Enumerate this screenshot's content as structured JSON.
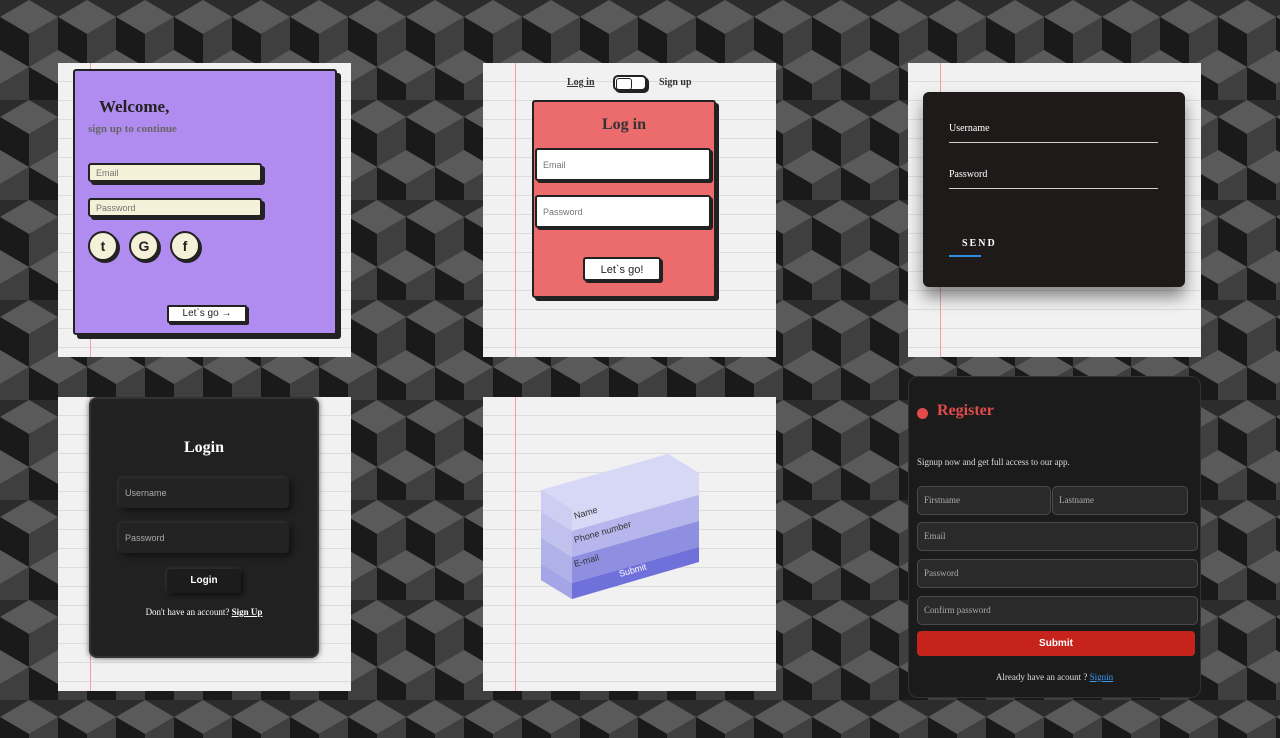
{
  "colors": {
    "background": "#2e2e2e",
    "paper": "#f1f1f1",
    "purple": "#b18cf0",
    "coral": "#ec6b6c",
    "dark": "#1e1a1a",
    "register_red": "#e24b4b",
    "link_blue": "#3b9cf2"
  },
  "card1": {
    "title": "Welcome,",
    "subtitle": "sign up to continue",
    "email_placeholder": "Email",
    "password_placeholder": "Password",
    "social": [
      {
        "icon": "twitter-icon",
        "glyph": "t"
      },
      {
        "icon": "google-icon",
        "glyph": "G"
      },
      {
        "icon": "facebook-icon",
        "glyph": "f"
      }
    ],
    "button_label": "Let`s go →"
  },
  "card2": {
    "toggle_login": "Log in",
    "toggle_signup": "Sign up",
    "title": "Log in",
    "email_placeholder": "Email",
    "password_placeholder": "Password",
    "button_label": "Let`s go!"
  },
  "card3": {
    "username_label": "Username",
    "password_label": "Password",
    "send_label": "SEND"
  },
  "card4": {
    "title": "Login",
    "username_placeholder": "Username",
    "password_placeholder": "Password",
    "button_label": "Login",
    "footer_text": "Don't have an account?",
    "signup_link": "Sign Up"
  },
  "card5": {
    "fields": [
      "Name",
      "Phone number",
      "E-mail"
    ],
    "submit_label": "Submit"
  },
  "card6": {
    "title": "Register",
    "subtitle": "Signup now and get full access to our app.",
    "firstname_placeholder": "Firstname",
    "lastname_placeholder": "Lastname",
    "email_placeholder": "Email",
    "password_placeholder": "Password",
    "confirm_placeholder": "Confirm password",
    "submit_label": "Submit",
    "footer_text": "Already have an acount ?",
    "signin_link": "Signin"
  }
}
